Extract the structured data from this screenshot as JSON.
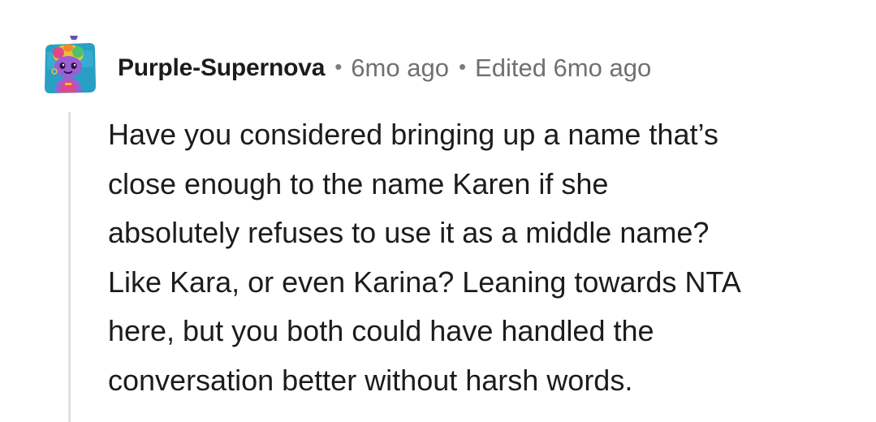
{
  "comment": {
    "author": "Purple-Supernova",
    "separator": "•",
    "posted": "6mo ago",
    "edited": "Edited 6mo ago",
    "body": "Have you considered bringing up a name that’s\nclose enough to the name Karen if she\nabsolutely refuses to use it as a middle name?\nLike Kara, or even Karina? Leaning towards NTA\nhere, but you both could have handled the\nconversation better without harsh words.",
    "avatar_icon": "snoo-avatar-icon"
  },
  "colors": {
    "username": "#1c1c1c",
    "meta": "#707070",
    "thread_line": "#e2e2e2",
    "avatar_bg": "#2a9fc4",
    "avatar_body": "#9b5fd4"
  }
}
